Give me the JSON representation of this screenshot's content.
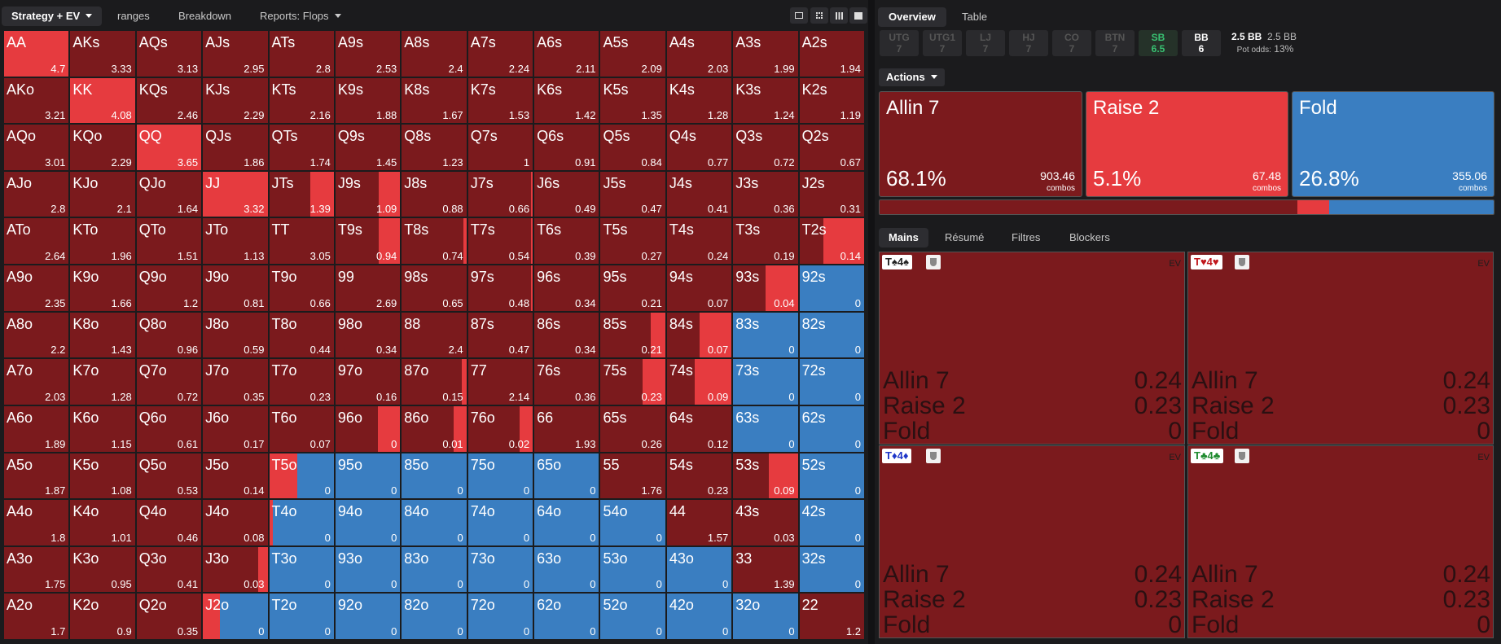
{
  "colors": {
    "allin": "#7b1a1d",
    "raise": "#e63b3f",
    "fold": "#3a7ec1",
    "bg": "#1b1b1d"
  },
  "toolbar": {
    "strategy_ev": "Strategy + EV",
    "ranges": "ranges",
    "breakdown": "Breakdown",
    "reports": "Reports: Flops"
  },
  "right_tabs": {
    "overview": "Overview",
    "table": "Table"
  },
  "positions": [
    {
      "name": "UTG",
      "stack": "7"
    },
    {
      "name": "UTG1",
      "stack": "7"
    },
    {
      "name": "LJ",
      "stack": "7"
    },
    {
      "name": "HJ",
      "stack": "7"
    },
    {
      "name": "CO",
      "stack": "7"
    },
    {
      "name": "BTN",
      "stack": "7"
    },
    {
      "name": "SB",
      "stack": "6.5"
    },
    {
      "name": "BB",
      "stack": "6"
    }
  ],
  "blinds": {
    "pot": "2.5 BB",
    "pot2": "2.5 BB",
    "pot_odds_label": "Pot odds:",
    "pot_odds": "13%"
  },
  "actions_menu": "Actions",
  "action_boxes": [
    {
      "label": "Allin 7",
      "pct": "68.1%",
      "combos": "903.46",
      "combos_label": "combos"
    },
    {
      "label": "Raise 2",
      "pct": "5.1%",
      "combos": "67.48",
      "combos_label": "combos"
    },
    {
      "label": "Fold",
      "pct": "26.8%",
      "combos": "355.06",
      "combos_label": "combos"
    }
  ],
  "freq_bar": {
    "allin": 0.681,
    "raise": 0.051,
    "fold": 0.268
  },
  "sub_tabs": {
    "mains": "Mains",
    "resume": "Résumé",
    "filtres": "Filtres",
    "blockers": "Blockers"
  },
  "combos": [
    {
      "rank1": "T",
      "suit1": "♠",
      "rank2": "4",
      "suit2": "♠",
      "color": "#222",
      "ev_label": "EV",
      "rows": [
        {
          "label": "Allin 7",
          "value": "0.24"
        },
        {
          "label": "Raise 2",
          "value": "0.23"
        },
        {
          "label": "Fold",
          "value": "0"
        }
      ]
    },
    {
      "rank1": "T",
      "suit1": "♥",
      "rank2": "4",
      "suit2": "♥",
      "color": "#c0181d",
      "ev_label": "EV",
      "rows": [
        {
          "label": "Allin 7",
          "value": "0.24"
        },
        {
          "label": "Raise 2",
          "value": "0.23"
        },
        {
          "label": "Fold",
          "value": "0"
        }
      ]
    },
    {
      "rank1": "T",
      "suit1": "♦",
      "rank2": "4",
      "suit2": "♦",
      "color": "#1d35c8",
      "ev_label": "EV",
      "rows": [
        {
          "label": "Allin 7",
          "value": "0.24"
        },
        {
          "label": "Raise 2",
          "value": "0.23"
        },
        {
          "label": "Fold",
          "value": "0"
        }
      ]
    },
    {
      "rank1": "T",
      "suit1": "♣",
      "rank2": "4",
      "suit2": "♣",
      "color": "#1e8a2e",
      "ev_label": "EV",
      "rows": [
        {
          "label": "Allin 7",
          "value": "0.24"
        },
        {
          "label": "Raise 2",
          "value": "0.23"
        },
        {
          "label": "Fold",
          "value": "0"
        }
      ]
    }
  ],
  "matrix": {
    "rows": [
      [
        {
          "h": "AA",
          "ev": "4.7",
          "r": 1
        },
        {
          "h": "AKs",
          "ev": "3.33"
        },
        {
          "h": "AQs",
          "ev": "3.13"
        },
        {
          "h": "AJs",
          "ev": "2.95"
        },
        {
          "h": "ATs",
          "ev": "2.8"
        },
        {
          "h": "A9s",
          "ev": "2.53"
        },
        {
          "h": "A8s",
          "ev": "2.4"
        },
        {
          "h": "A7s",
          "ev": "2.24"
        },
        {
          "h": "A6s",
          "ev": "2.11"
        },
        {
          "h": "A5s",
          "ev": "2.09"
        },
        {
          "h": "A4s",
          "ev": "2.03"
        },
        {
          "h": "A3s",
          "ev": "1.99"
        },
        {
          "h": "A2s",
          "ev": "1.94"
        }
      ],
      [
        {
          "h": "AKo",
          "ev": "3.21"
        },
        {
          "h": "KK",
          "ev": "4.08",
          "r": 1
        },
        {
          "h": "KQs",
          "ev": "2.46"
        },
        {
          "h": "KJs",
          "ev": "2.29"
        },
        {
          "h": "KTs",
          "ev": "2.16"
        },
        {
          "h": "K9s",
          "ev": "1.88"
        },
        {
          "h": "K8s",
          "ev": "1.67"
        },
        {
          "h": "K7s",
          "ev": "1.53"
        },
        {
          "h": "K6s",
          "ev": "1.42"
        },
        {
          "h": "K5s",
          "ev": "1.35"
        },
        {
          "h": "K4s",
          "ev": "1.28"
        },
        {
          "h": "K3s",
          "ev": "1.24"
        },
        {
          "h": "K2s",
          "ev": "1.19"
        }
      ],
      [
        {
          "h": "AQo",
          "ev": "3.01"
        },
        {
          "h": "KQo",
          "ev": "2.29"
        },
        {
          "h": "QQ",
          "ev": "3.65",
          "r": 1
        },
        {
          "h": "QJs",
          "ev": "1.86"
        },
        {
          "h": "QTs",
          "ev": "1.74"
        },
        {
          "h": "Q9s",
          "ev": "1.45"
        },
        {
          "h": "Q8s",
          "ev": "1.23"
        },
        {
          "h": "Q7s",
          "ev": "1"
        },
        {
          "h": "Q6s",
          "ev": "0.91"
        },
        {
          "h": "Q5s",
          "ev": "0.84"
        },
        {
          "h": "Q4s",
          "ev": "0.77"
        },
        {
          "h": "Q3s",
          "ev": "0.72"
        },
        {
          "h": "Q2s",
          "ev": "0.67"
        }
      ],
      [
        {
          "h": "AJo",
          "ev": "2.8"
        },
        {
          "h": "KJo",
          "ev": "2.1"
        },
        {
          "h": "QJo",
          "ev": "1.64"
        },
        {
          "h": "JJ",
          "ev": "3.32",
          "r": 1
        },
        {
          "h": "JTs",
          "ev": "1.39",
          "r": 0.37
        },
        {
          "h": "J9s",
          "ev": "1.09",
          "r": 0.33
        },
        {
          "h": "J8s",
          "ev": "0.88"
        },
        {
          "h": "J7s",
          "ev": "0.66",
          "r": 0.03
        },
        {
          "h": "J6s",
          "ev": "0.49"
        },
        {
          "h": "J5s",
          "ev": "0.47"
        },
        {
          "h": "J4s",
          "ev": "0.41"
        },
        {
          "h": "J3s",
          "ev": "0.36"
        },
        {
          "h": "J2s",
          "ev": "0.31"
        }
      ],
      [
        {
          "h": "ATo",
          "ev": "2.64"
        },
        {
          "h": "KTo",
          "ev": "1.96"
        },
        {
          "h": "QTo",
          "ev": "1.51"
        },
        {
          "h": "JTo",
          "ev": "1.13"
        },
        {
          "h": "TT",
          "ev": "3.05"
        },
        {
          "h": "T9s",
          "ev": "0.94",
          "r": 0.33
        },
        {
          "h": "T8s",
          "ev": "0.74",
          "r": 0.05
        },
        {
          "h": "T7s",
          "ev": "0.54",
          "r": 0.03
        },
        {
          "h": "T6s",
          "ev": "0.39"
        },
        {
          "h": "T5s",
          "ev": "0.27"
        },
        {
          "h": "T4s",
          "ev": "0.24"
        },
        {
          "h": "T3s",
          "ev": "0.19"
        },
        {
          "h": "T2s",
          "ev": "0.14",
          "r": 0.63
        }
      ],
      [
        {
          "h": "A9o",
          "ev": "2.35"
        },
        {
          "h": "K9o",
          "ev": "1.66"
        },
        {
          "h": "Q9o",
          "ev": "1.2"
        },
        {
          "h": "J9o",
          "ev": "0.81"
        },
        {
          "h": "T9o",
          "ev": "0.66"
        },
        {
          "h": "99",
          "ev": "2.69"
        },
        {
          "h": "98s",
          "ev": "0.65"
        },
        {
          "h": "97s",
          "ev": "0.48",
          "r": 0.02
        },
        {
          "h": "96s",
          "ev": "0.34"
        },
        {
          "h": "95s",
          "ev": "0.21"
        },
        {
          "h": "94s",
          "ev": "0.07"
        },
        {
          "h": "93s",
          "ev": "0.04",
          "r": 0.5
        },
        {
          "h": "92s",
          "ev": "0",
          "f": 1
        }
      ],
      [
        {
          "h": "A8o",
          "ev": "2.2"
        },
        {
          "h": "K8o",
          "ev": "1.43"
        },
        {
          "h": "Q8o",
          "ev": "0.96"
        },
        {
          "h": "J8o",
          "ev": "0.59"
        },
        {
          "h": "T8o",
          "ev": "0.44"
        },
        {
          "h": "98o",
          "ev": "0.34"
        },
        {
          "h": "88",
          "ev": "2.4"
        },
        {
          "h": "87s",
          "ev": "0.47"
        },
        {
          "h": "86s",
          "ev": "0.34"
        },
        {
          "h": "85s",
          "ev": "0.21",
          "r": 0.22
        },
        {
          "h": "84s",
          "ev": "0.07",
          "r": 0.5
        },
        {
          "h": "83s",
          "ev": "0",
          "f": 1
        },
        {
          "h": "82s",
          "ev": "0",
          "f": 1
        }
      ],
      [
        {
          "h": "A7o",
          "ev": "2.03"
        },
        {
          "h": "K7o",
          "ev": "1.28"
        },
        {
          "h": "Q7o",
          "ev": "0.72"
        },
        {
          "h": "J7o",
          "ev": "0.35"
        },
        {
          "h": "T7o",
          "ev": "0.23"
        },
        {
          "h": "97o",
          "ev": "0.16"
        },
        {
          "h": "87o",
          "ev": "0.15",
          "r": 0.07
        },
        {
          "h": "77",
          "ev": "2.14"
        },
        {
          "h": "76s",
          "ev": "0.36"
        },
        {
          "h": "75s",
          "ev": "0.23",
          "r": 0.35
        },
        {
          "h": "74s",
          "ev": "0.09",
          "r": 0.57
        },
        {
          "h": "73s",
          "ev": "0",
          "f": 1
        },
        {
          "h": "72s",
          "ev": "0",
          "f": 1
        }
      ],
      [
        {
          "h": "A6o",
          "ev": "1.89"
        },
        {
          "h": "K6o",
          "ev": "1.15"
        },
        {
          "h": "Q6o",
          "ev": "0.61"
        },
        {
          "h": "J6o",
          "ev": "0.17"
        },
        {
          "h": "T6o",
          "ev": "0.07"
        },
        {
          "h": "96o",
          "ev": "0",
          "r": 0.35
        },
        {
          "h": "86o",
          "ev": "0.01",
          "r": 0.2
        },
        {
          "h": "76o",
          "ev": "0.02",
          "r": 0.2
        },
        {
          "h": "66",
          "ev": "1.93"
        },
        {
          "h": "65s",
          "ev": "0.26"
        },
        {
          "h": "64s",
          "ev": "0.12"
        },
        {
          "h": "63s",
          "ev": "0",
          "f": 1
        },
        {
          "h": "62s",
          "ev": "0",
          "f": 1
        }
      ],
      [
        {
          "h": "A5o",
          "ev": "1.87"
        },
        {
          "h": "K5o",
          "ev": "1.08"
        },
        {
          "h": "Q5o",
          "ev": "0.53"
        },
        {
          "h": "J5o",
          "ev": "0.14"
        },
        {
          "h": "T5o",
          "ev": "0",
          "r": 0.43,
          "f": 0.57
        },
        {
          "h": "95o",
          "ev": "0",
          "f": 1
        },
        {
          "h": "85o",
          "ev": "0",
          "f": 1
        },
        {
          "h": "75o",
          "ev": "0",
          "f": 1
        },
        {
          "h": "65o",
          "ev": "0",
          "f": 1
        },
        {
          "h": "55",
          "ev": "1.76"
        },
        {
          "h": "54s",
          "ev": "0.23"
        },
        {
          "h": "53s",
          "ev": "0.09",
          "r": 0.45
        },
        {
          "h": "52s",
          "ev": "0",
          "f": 1
        }
      ],
      [
        {
          "h": "A4o",
          "ev": "1.8"
        },
        {
          "h": "K4o",
          "ev": "1.01"
        },
        {
          "h": "Q4o",
          "ev": "0.46"
        },
        {
          "h": "J4o",
          "ev": "0.08"
        },
        {
          "h": "T4o",
          "ev": "0",
          "r": 0.06,
          "f": 0.94
        },
        {
          "h": "94o",
          "ev": "0",
          "f": 1
        },
        {
          "h": "84o",
          "ev": "0",
          "f": 1
        },
        {
          "h": "74o",
          "ev": "0",
          "f": 1
        },
        {
          "h": "64o",
          "ev": "0",
          "f": 1
        },
        {
          "h": "54o",
          "ev": "0",
          "f": 1
        },
        {
          "h": "44",
          "ev": "1.57"
        },
        {
          "h": "43s",
          "ev": "0.03"
        },
        {
          "h": "42s",
          "ev": "0",
          "f": 1
        }
      ],
      [
        {
          "h": "A3o",
          "ev": "1.75"
        },
        {
          "h": "K3o",
          "ev": "0.95"
        },
        {
          "h": "Q3o",
          "ev": "0.41"
        },
        {
          "h": "J3o",
          "ev": "0.03",
          "r": 0.15
        },
        {
          "h": "T3o",
          "ev": "0",
          "f": 1
        },
        {
          "h": "93o",
          "ev": "0",
          "f": 1
        },
        {
          "h": "83o",
          "ev": "0",
          "f": 1
        },
        {
          "h": "73o",
          "ev": "0",
          "f": 1
        },
        {
          "h": "63o",
          "ev": "0",
          "f": 1
        },
        {
          "h": "53o",
          "ev": "0",
          "f": 1
        },
        {
          "h": "43o",
          "ev": "0",
          "f": 1
        },
        {
          "h": "33",
          "ev": "1.39"
        },
        {
          "h": "32s",
          "ev": "0",
          "f": 1
        }
      ],
      [
        {
          "h": "A2o",
          "ev": "1.7"
        },
        {
          "h": "K2o",
          "ev": "0.9"
        },
        {
          "h": "Q2o",
          "ev": "0.35"
        },
        {
          "h": "J2o",
          "ev": "0",
          "r": 0.26,
          "f": 0.74,
          "ra": 1
        },
        {
          "h": "T2o",
          "ev": "0",
          "f": 1
        },
        {
          "h": "92o",
          "ev": "0",
          "f": 1
        },
        {
          "h": "82o",
          "ev": "0",
          "f": 1
        },
        {
          "h": "72o",
          "ev": "0",
          "f": 1
        },
        {
          "h": "62o",
          "ev": "0",
          "f": 1
        },
        {
          "h": "52o",
          "ev": "0",
          "f": 1
        },
        {
          "h": "42o",
          "ev": "0",
          "f": 1
        },
        {
          "h": "32o",
          "ev": "0",
          "f": 1
        },
        {
          "h": "22",
          "ev": "1.2"
        }
      ]
    ]
  }
}
